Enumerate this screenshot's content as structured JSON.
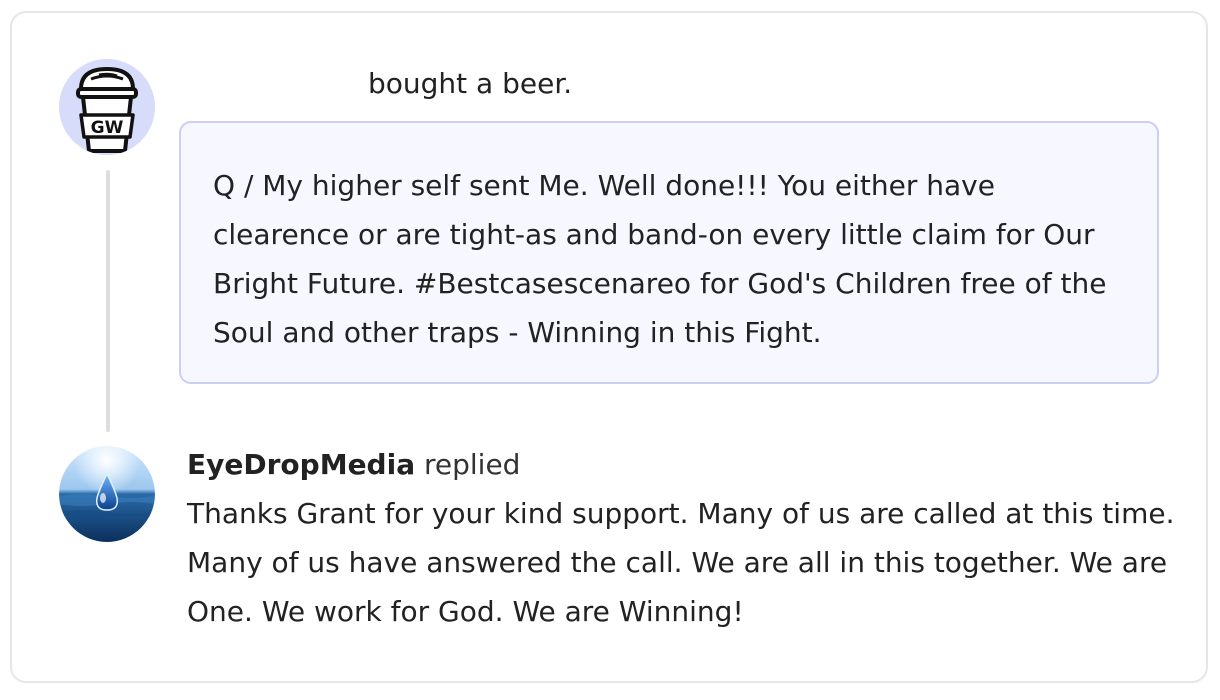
{
  "support": {
    "headline": "bought a beer.",
    "message": "Q / My higher self sent Me. Well done!!! You either have clearence or are tight-as and band-on every little claim for Our Bright Future. #Bestcasescenareo for God's Children free of the Soul and other traps - Winning in this Fight.",
    "avatar_text": "GW",
    "avatar_icon": "coffee-cup-icon"
  },
  "reply": {
    "creator_name": "EyeDropMedia",
    "replied_label": "replied",
    "message": "Thanks Grant for your kind support. Many of us are called at this time. Many of us have answered the call. We are all in this together. We are One. We work for God. We are Winning!",
    "avatar_icon": "water-drop-ocean-icon"
  },
  "colors": {
    "card_border": "#e6e6e6",
    "message_bg": "#f6f7ff",
    "message_border": "#c9d0f3",
    "avatar_bg": "#d8dcfb",
    "thread_line": "#dedede"
  }
}
